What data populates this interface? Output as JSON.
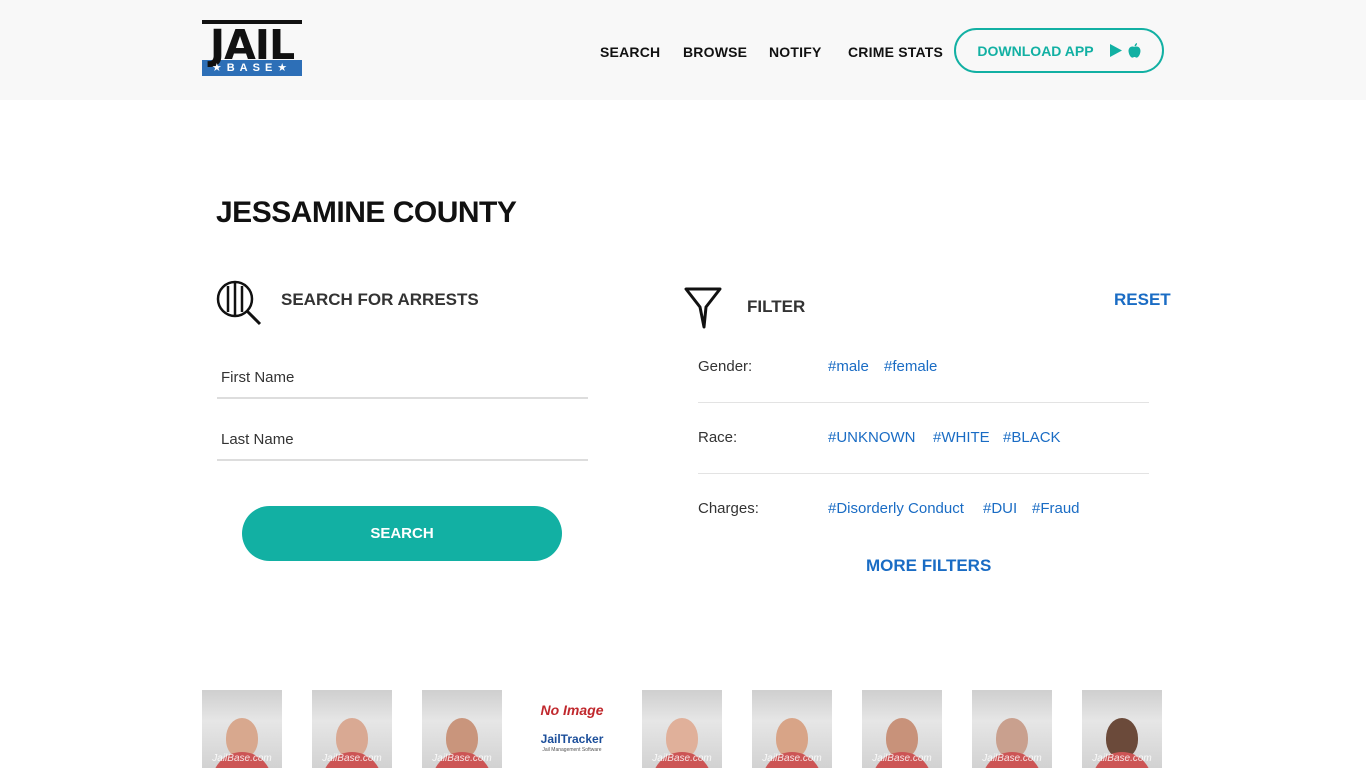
{
  "header": {
    "logo": {
      "top": "JAIL",
      "bottom": "BASE"
    },
    "nav": [
      "SEARCH",
      "BROWSE",
      "NOTIFY",
      "CRIME STATS"
    ],
    "download_label": "DOWNLOAD APP"
  },
  "page_title": "JESSAMINE COUNTY",
  "search": {
    "heading": "SEARCH FOR ARRESTS",
    "first_name_placeholder": "First Name",
    "last_name_placeholder": "Last Name",
    "button_label": "SEARCH"
  },
  "filter": {
    "heading": "FILTER",
    "reset_label": "RESET",
    "rows": [
      {
        "label": "Gender:",
        "tags": [
          "#male",
          "#female"
        ]
      },
      {
        "label": "Race:",
        "tags": [
          "#UNKNOWN",
          "#WHITE",
          "#BLACK"
        ]
      },
      {
        "label": "Charges:",
        "tags": [
          "#Disorderly Conduct",
          "#DUI",
          "#Fraud"
        ]
      }
    ],
    "more_label": "MORE FILTERS"
  },
  "mugshots": {
    "watermark": "JailBase.com",
    "no_image": {
      "line1": "No Image",
      "line2": "JailTracker",
      "line3": "Jail Management Software"
    }
  },
  "colors": {
    "accent": "#12b0a3",
    "link": "#1a6cc4",
    "logo_blue": "#2d6fb7"
  }
}
